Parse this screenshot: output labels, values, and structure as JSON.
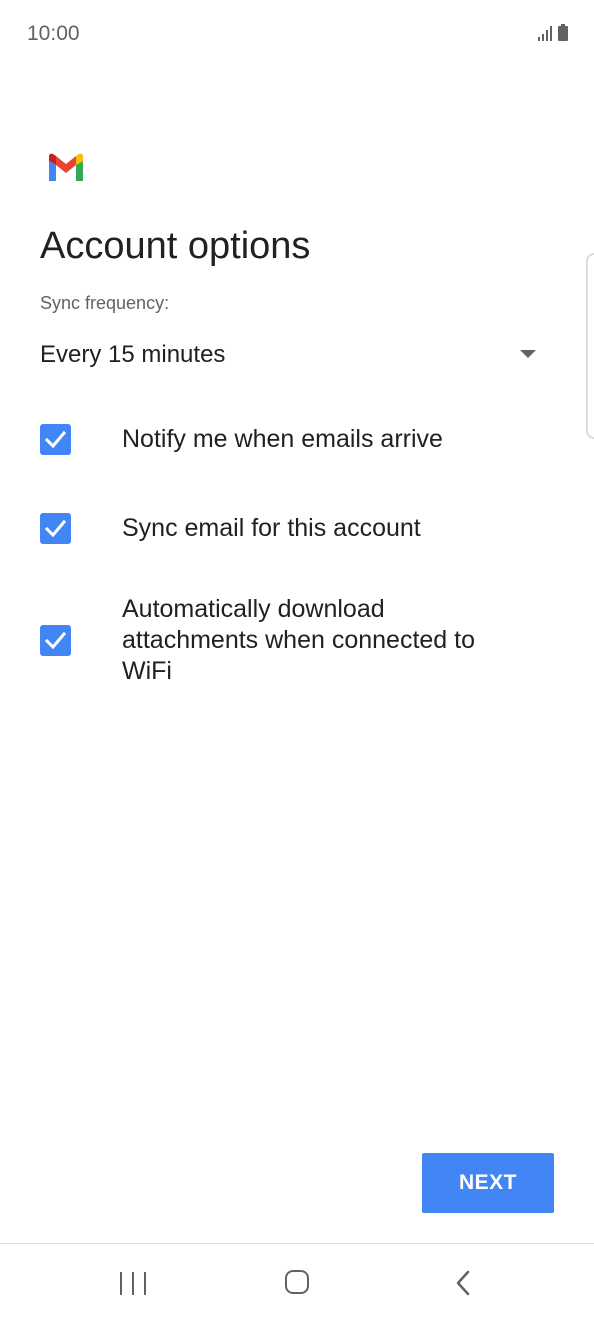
{
  "status_bar": {
    "time": "10:00",
    "icons": [
      "signal-icon",
      "battery-icon"
    ]
  },
  "app": {
    "logo": "gmail-logo",
    "brand_colors": {
      "red": "#EA4335",
      "blue": "#4285F4",
      "green": "#34A853",
      "yellow": "#FBBC05",
      "dark_red": "#C5221F"
    }
  },
  "page": {
    "title": "Account options"
  },
  "sync": {
    "label": "Sync frequency:",
    "selected": "Every 15 minutes"
  },
  "options": [
    {
      "label": "Notify me when emails arrive",
      "checked": true
    },
    {
      "label": "Sync email for this account",
      "checked": true
    },
    {
      "label": "Automatically download attachments when connected to WiFi",
      "checked": true
    }
  ],
  "actions": {
    "next_label": "NEXT"
  },
  "nav_bar": {
    "icons": [
      "recents-icon",
      "home-icon",
      "back-icon"
    ]
  },
  "colors": {
    "accent": "#4285F4",
    "text_primary": "#202124",
    "text_secondary": "#5F6368"
  }
}
